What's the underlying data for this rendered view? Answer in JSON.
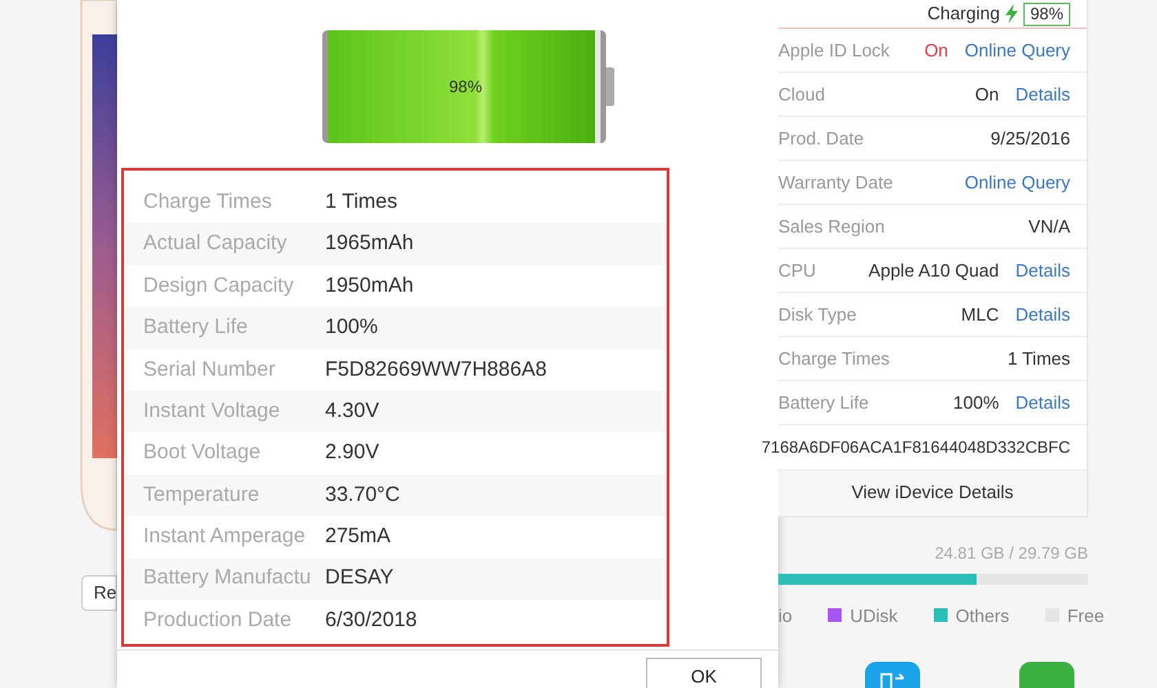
{
  "side_button": {
    "label": "Re"
  },
  "dialog": {
    "battery": {
      "level": 0.98,
      "label": "98%"
    },
    "rows": [
      {
        "label": "Charge Times",
        "value": "1 Times"
      },
      {
        "label": "Actual Capacity",
        "value": "1965mAh"
      },
      {
        "label": "Design Capacity",
        "value": "1950mAh"
      },
      {
        "label": "Battery Life",
        "value": "100%"
      },
      {
        "label": "Serial Number",
        "value": "F5D82669WW7H886A8"
      },
      {
        "label": "Instant Voltage",
        "value": "4.30V"
      },
      {
        "label": "Boot Voltage",
        "value": "2.90V"
      },
      {
        "label": "Temperature",
        "value": "33.70°C"
      },
      {
        "label": "Instant Amperage",
        "value": "275mA"
      },
      {
        "label": "Battery Manufactu",
        "value": "DESAY"
      },
      {
        "label": "Production Date",
        "value": "6/30/2018"
      }
    ],
    "ok_button": "OK"
  },
  "device_panel": {
    "status": {
      "label": "Charging",
      "battery": "98%"
    },
    "rows": [
      {
        "label": "Apple ID Lock",
        "value": "On",
        "warning": true,
        "link": "Online Query"
      },
      {
        "label": "Cloud",
        "value": "On",
        "warning": false,
        "link": "Details"
      },
      {
        "label": "Prod. Date",
        "value": "9/25/2016",
        "warning": false
      },
      {
        "label": "Warranty Date",
        "warning": false,
        "link": "Online Query"
      },
      {
        "label": "Sales Region",
        "value": "VN/A",
        "warning": false
      },
      {
        "label": "CPU",
        "value": "Apple A10 Quad",
        "warning": false,
        "link": "Details"
      },
      {
        "label": "Disk Type",
        "value": "MLC",
        "warning": false,
        "link": "Details"
      },
      {
        "label": "Charge Times",
        "value": "1 Times",
        "warning": false
      },
      {
        "label": "Battery Life",
        "value": "100%",
        "warning": false,
        "link": "Details"
      }
    ],
    "udid": "7168A6DF06ACA1F81644048D332CBFC",
    "details_button": "View iDevice Details",
    "storage": {
      "text": "24.81 GB / 29.79 GB",
      "level": 0.64
    },
    "legend": [
      {
        "label": "io"
      },
      {
        "label": "UDisk",
        "color": "#a855f7"
      },
      {
        "label": "Others",
        "color": "#2bbfb8"
      },
      {
        "label": "Free",
        "color": "#e5e5e5"
      }
    ]
  }
}
